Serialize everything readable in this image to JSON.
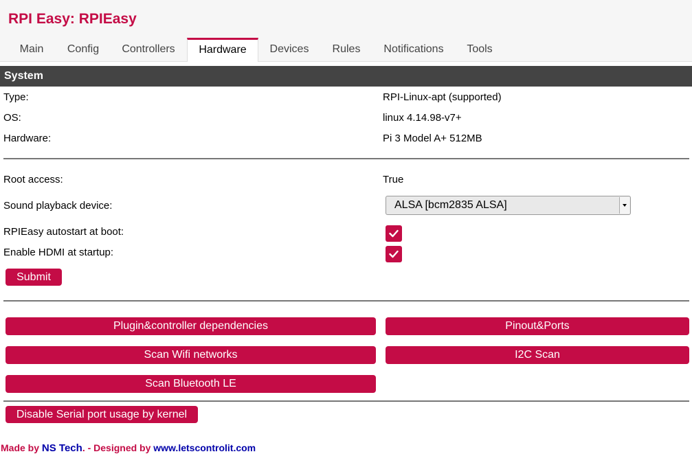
{
  "header": {
    "title": "RPI Easy: RPIEasy"
  },
  "tabs": [
    {
      "label": "Main",
      "active": false
    },
    {
      "label": "Config",
      "active": false
    },
    {
      "label": "Controllers",
      "active": false
    },
    {
      "label": "Hardware",
      "active": true
    },
    {
      "label": "Devices",
      "active": false
    },
    {
      "label": "Rules",
      "active": false
    },
    {
      "label": "Notifications",
      "active": false
    },
    {
      "label": "Tools",
      "active": false
    }
  ],
  "system": {
    "heading": "System",
    "rows": [
      {
        "label": "Type:",
        "value": "RPI-Linux-apt (supported)"
      },
      {
        "label": "OS:",
        "value": "linux 4.14.98-v7+"
      },
      {
        "label": "Hardware:",
        "value": "Pi 3 Model A+ 512MB"
      }
    ]
  },
  "settings": {
    "root_label": "Root access:",
    "root_value": "True",
    "sound_label": "Sound playback device:",
    "sound_value": "ALSA [bcm2835 ALSA]",
    "autostart_label": "RPIEasy autostart at boot:",
    "autostart_checked": true,
    "hdmi_label": "Enable HDMI at startup:",
    "hdmi_checked": true,
    "submit_label": "Submit"
  },
  "actions": {
    "plugin_deps": "Plugin&controller dependencies",
    "pinout": "Pinout&Ports",
    "scan_wifi": "Scan Wifi networks",
    "i2c_scan": "I2C Scan",
    "scan_bt": "Scan Bluetooth LE",
    "disable_serial": "Disable Serial port usage by kernel"
  },
  "footer": {
    "made_by": "Made by",
    "ns_tech": "NS Tech",
    "designed_by": ". - Designed by",
    "site": "www.letscontrolit.com"
  },
  "colors": {
    "accent": "#c40c46",
    "section_bar": "#444444",
    "footer_link": "#0000aa"
  },
  "icons": {
    "checkbox": "check-icon",
    "select_arrow": "chevron-down-icon"
  }
}
